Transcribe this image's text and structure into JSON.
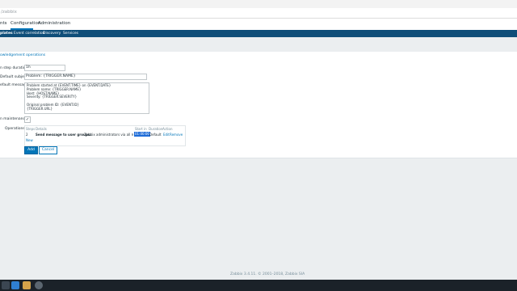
{
  "browser": {
    "url": "/zabbix"
  },
  "main_nav": {
    "items": [
      "nts",
      "Configuration",
      "Administration"
    ]
  },
  "sub_nav": {
    "items": [
      "plates",
      "Event correlation",
      "Discovery",
      "Services"
    ]
  },
  "tabs": {
    "active": "owledgement operations"
  },
  "form": {
    "step_duration_label": "n step duration",
    "step_duration_value": "1h",
    "default_subject_label": "Default subject",
    "default_subject_value": "Problem: {TRIGGER.NAME}",
    "default_message_label": "efault message",
    "default_message_value": "Problem started at {EVENT.TIME} on {EVENT.DATE}\nProblem name: {TRIGGER.NAME}\nHost: {HOST.NAME}\nSeverity: {TRIGGER.SEVERITY}\n\nOriginal problem ID: {EVENT.ID}\n{TRIGGER.URL}",
    "maintenance_label": "n maintenance",
    "maintenance_checked": "✓",
    "operations_label": "Operations"
  },
  "operations": {
    "headers": {
      "steps": "Steps",
      "details": "Details",
      "start_in": "Start in",
      "duration": "Duration",
      "action": "Action"
    },
    "row": {
      "steps": "2",
      "details_bold": "Send message to user groups:",
      "details_rest": "Zabbix administrators via all media",
      "start_in": "01:00:00",
      "duration": "Default",
      "edit": "Edit",
      "remove": "Remove"
    },
    "new_link": "New"
  },
  "buttons": {
    "add": "Add",
    "cancel": "Cancel"
  },
  "footer": {
    "text": "Zabbix 3.4.11. © 2001–2018, Zabbix SIA"
  },
  "colors": {
    "accent": "#0275b8",
    "subnav": "#0f4e79",
    "selection": "#1e6cd8"
  },
  "taskbar": {
    "icons": [
      "start-icon",
      "browser-icon",
      "files-icon",
      "app-icon",
      "chrome-icon"
    ]
  }
}
